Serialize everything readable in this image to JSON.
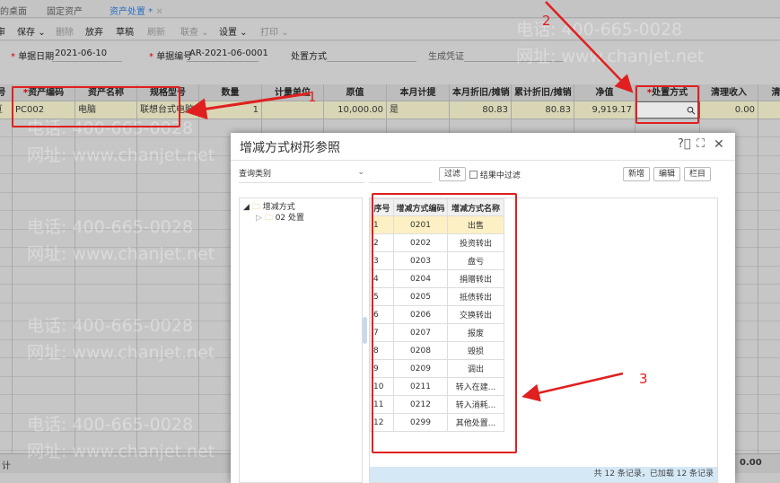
{
  "tabs": [
    {
      "label": "我的桌面"
    },
    {
      "label": "固定资产"
    },
    {
      "label": "资产处置 *"
    }
  ],
  "toolbar": {
    "first": "审",
    "save": "保存",
    "delete": "删除",
    "discard": "放弃",
    "draft": "草稿",
    "refresh": "刷新",
    "link": "联查",
    "settings": "设置",
    "print": "打印"
  },
  "form": {
    "date_label": "单据日期",
    "date_value": "2021-06-10",
    "number_label": "单据编号",
    "number_value": "AR-2021-06-0001",
    "method_label": "处置方式",
    "voucher_label": "生成凭证"
  },
  "grid": {
    "headers": [
      "号",
      "资产编码",
      "资产名称",
      "规格型号",
      "数量",
      "计量单位",
      "原值",
      "本月计提",
      "本月折旧/摊销",
      "累计折旧/摊销",
      "净值",
      "处置方式",
      "清理收入",
      "清"
    ],
    "row": {
      "index": "亘",
      "code": "PC002",
      "name": "电脑",
      "spec": "联想台式电脑",
      "qty": "1",
      "unit": "",
      "original": "10,000.00",
      "accrue": "是",
      "month_dep": "80.83",
      "total_dep": "80.83",
      "net": "9,919.17",
      "method": "",
      "income": "0.00"
    },
    "total_label": "计",
    "total_income": "0.00"
  },
  "watermark": {
    "phone": "电话: 400-665-0028",
    "site": "网址: www.chanjet.net"
  },
  "dialog": {
    "title": "增减方式树形参照",
    "query_placeholder": "查询类别",
    "filter": "过滤",
    "filter_in_result": "结果中过滤",
    "new": "新增",
    "edit": "编辑",
    "columns": "栏目",
    "tree": {
      "root": "增减方式",
      "child": "02 处置"
    },
    "table": {
      "headers": [
        "序号",
        "增减方式编码",
        "增减方式名称"
      ],
      "rows": [
        [
          "1",
          "0201",
          "出售"
        ],
        [
          "2",
          "0202",
          "投资转出"
        ],
        [
          "3",
          "0203",
          "盘亏"
        ],
        [
          "4",
          "0204",
          "捐赠转出"
        ],
        [
          "5",
          "0205",
          "抵债转出"
        ],
        [
          "6",
          "0206",
          "交换转出"
        ],
        [
          "7",
          "0207",
          "报废"
        ],
        [
          "8",
          "0208",
          "毁损"
        ],
        [
          "9",
          "0209",
          "调出"
        ],
        [
          "10",
          "0211",
          "转入在建..."
        ],
        [
          "11",
          "0212",
          "转入消耗..."
        ],
        [
          "12",
          "0299",
          "其他处置..."
        ]
      ]
    },
    "footer": "共 12 条记录，已加载 12 条记录"
  },
  "annotations": {
    "one": "1",
    "two": "2",
    "three": "3"
  },
  "colors": {
    "accent": "#2a6fc0",
    "annotation": "#e02020",
    "selected_row": "#fdf0c4"
  }
}
